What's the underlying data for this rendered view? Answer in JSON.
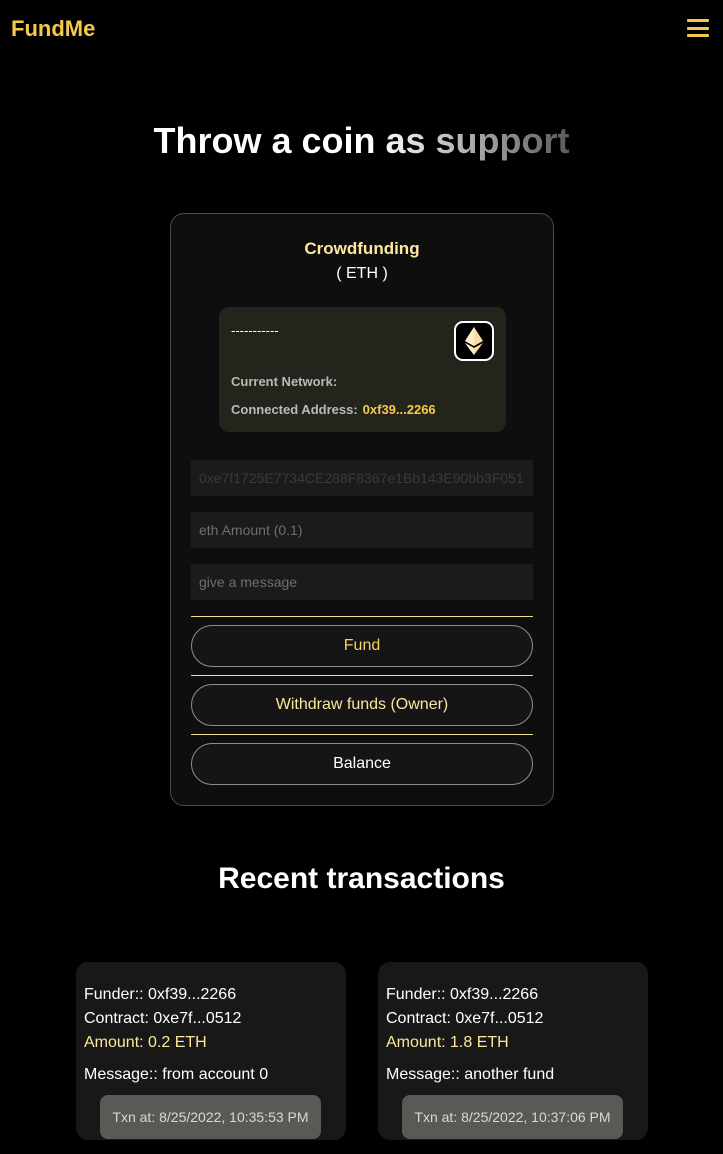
{
  "brand": "FundMe",
  "hero_title": "Throw a coin as support",
  "card": {
    "title": "Crowdfunding",
    "subtitle": "( ETH )",
    "info": {
      "network_placeholder": "-----------",
      "network_label": "Current Network:",
      "address_label": "Connected Address:",
      "address_value": "0xf39...2266"
    },
    "fields": {
      "contract_placeholder": "0xe7f1725E7734CE288F8367e1Bb143E90bb3F0512",
      "amount_placeholder": "eth Amount (0.1)",
      "message_placeholder": "give a message"
    },
    "buttons": {
      "fund": "Fund",
      "withdraw": "Withdraw funds (Owner)",
      "balance": "Balance"
    }
  },
  "recent_title": "Recent transactions",
  "transactions": [
    {
      "funder": "Funder:: 0xf39...2266",
      "contract": "Contract: 0xe7f...0512",
      "amount": "Amount: 0.2 ETH",
      "message": "Message:: from account 0",
      "time": "Txn at: 8/25/2022, 10:35:53 PM"
    },
    {
      "funder": "Funder:: 0xf39...2266",
      "contract": "Contract: 0xe7f...0512",
      "amount": "Amount: 1.8 ETH",
      "message": "Message:: another fund",
      "time": "Txn at: 8/25/2022, 10:37:06 PM"
    }
  ],
  "icons": {
    "menu": "hamburger-menu-icon",
    "network": "ethereum-icon"
  },
  "colors": {
    "accent": "#f6c94b",
    "card_title": "#ffe79a",
    "background": "#000000"
  }
}
